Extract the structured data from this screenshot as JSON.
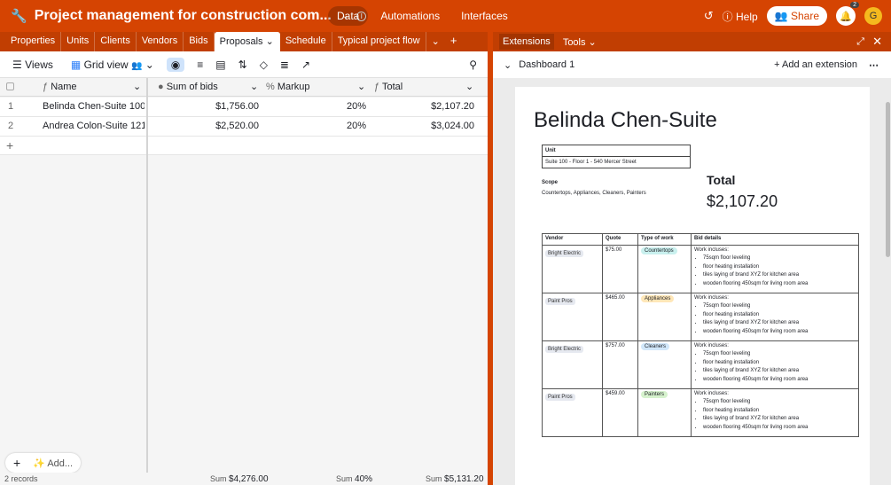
{
  "app": {
    "title": "Project management for construction com...",
    "nav": [
      "Data",
      "Automations",
      "Interfaces"
    ],
    "help_label": "Help",
    "share_label": "Share",
    "avatar_initial": "G",
    "notification_count": "2",
    "brand_color": "#d54402"
  },
  "tabs": [
    "Properties",
    "Units",
    "Clients",
    "Vendors",
    "Bids",
    "Proposals",
    "Schedule",
    "Typical project flow"
  ],
  "active_tab": "Proposals",
  "toolbar": {
    "views_label": "Views",
    "view_name": "Grid view"
  },
  "grid": {
    "columns": [
      "Name",
      "Sum of bids",
      "Markup",
      "Total"
    ],
    "rows": [
      {
        "num": "1",
        "name": "Belinda Chen-Suite 100 - Fl...",
        "sum": "$1,756.00",
        "markup": "20%",
        "total": "$2,107.20"
      },
      {
        "num": "2",
        "name": "Andrea Colon-Suite 121 - F...",
        "sum": "$2,520.00",
        "markup": "20%",
        "total": "$3,024.00"
      }
    ],
    "add_label": "Add...",
    "record_count": "2 records",
    "summary": {
      "sum_label": "Sum",
      "sum_bids": "$4,276.00",
      "sum_markup": "40%",
      "sum_total": "$5,131.20"
    }
  },
  "extensions": {
    "tab_label": "Extensions",
    "tools_label": "Tools",
    "dashboard_name": "Dashboard 1",
    "add_extension_label": "Add an extension"
  },
  "document": {
    "heading": "Belinda Chen-Suite",
    "unit_label": "Unit",
    "unit_value": "Suite 100 - Floor 1 - 540 Mercer Street",
    "scope_label": "Scope",
    "scope_value": "Countertops, Appliances, Cleaners, Painters",
    "total_label": "Total",
    "total_value": "$2,107.20",
    "table_headers": [
      "Vendor",
      "Quote",
      "Type of work",
      "Bid details"
    ],
    "bids": [
      {
        "vendor": "Bright Electric",
        "quote": "$75.00",
        "work": "Countertops",
        "work_color": "#c9f0ee"
      },
      {
        "vendor": "Paint Pros",
        "quote": "$465.00",
        "work": "Appliances",
        "work_color": "#ffe7b8"
      },
      {
        "vendor": "Bright Electric",
        "quote": "$757.00",
        "work": "Cleaners",
        "work_color": "#d1e7fa"
      },
      {
        "vendor": "Paint Pros",
        "quote": "$459.00",
        "work": "Painters",
        "work_color": "#d6f2cd"
      }
    ],
    "details_intro": "Work incluses:",
    "details_items": [
      "75sqm floor leveling",
      "floor heating installation",
      "tiles laying of brand XYZ for kitchen area",
      "wooden flooring 450sqm for living room area"
    ]
  }
}
